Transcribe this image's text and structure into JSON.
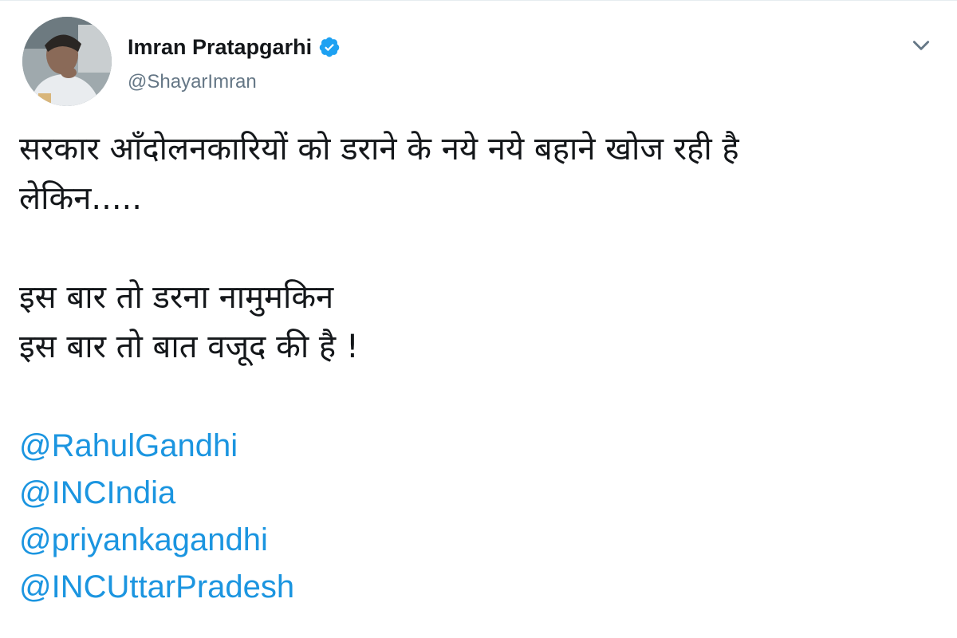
{
  "author": {
    "display_name": "Imran Pratapgarhi",
    "handle": "@ShayarImran",
    "verified": true
  },
  "icons": {
    "verified": "verified-badge-icon",
    "menu": "chevron-down-icon"
  },
  "tweet": {
    "lines": [
      "सरकार आँदोलनकारियों को डराने के नये नये बहाने खोज रही है",
      "लेकिन.....",
      "",
      "इस बार तो डरना नामुमकिन",
      "इस बार तो बात वजूद की है !"
    ],
    "mentions": [
      "@RahulGandhi",
      "@INCIndia",
      "@priyankagandhi",
      "@INCUttarPradesh"
    ]
  },
  "colors": {
    "link": "#1b95e0",
    "verified": "#1da1f2",
    "handle": "#657786",
    "text": "#14171a"
  }
}
